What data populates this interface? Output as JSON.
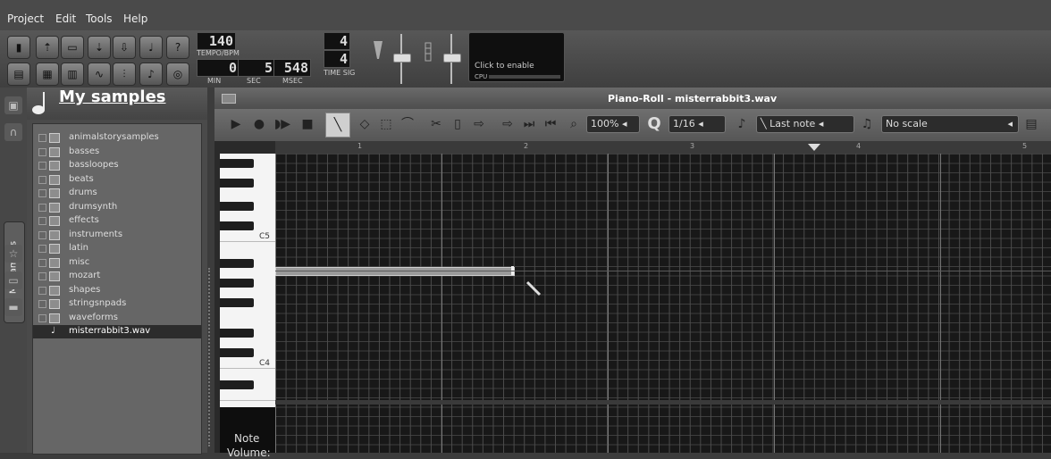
{
  "menu": [
    "Project",
    "Edit",
    "Tools",
    "Help"
  ],
  "transport": {
    "tempo": "140",
    "tempo_label": "TEMPO/BPM",
    "min": "0",
    "sec": "5",
    "msec": "548",
    "min_label": "MIN",
    "sec_label": "SEC",
    "msec_label": "MSEC",
    "timesig_num": "4",
    "timesig_den": "4",
    "timesig_label": "TIME SIG",
    "cpu_text": "Click to enable",
    "cpu_label": "CPU"
  },
  "sidebar": {
    "title": "My samples",
    "tab_label": "My samples",
    "items": [
      "animalstorysamples",
      "basses",
      "bassloopes",
      "beats",
      "drums",
      "drumsynth",
      "effects",
      "instruments",
      "latin",
      "misc",
      "mozart",
      "shapes",
      "stringsnpads",
      "waveforms"
    ],
    "selected_file": "misterrabbit3.wav"
  },
  "piano_roll": {
    "title": "Piano-Roll - misterrabbit3.wav",
    "zoom": "100%",
    "quantize_symbol": "Q",
    "quantize": "1/16",
    "note_length": "Last note",
    "scale": "No scale",
    "bar_numbers": [
      "1",
      "2",
      "3",
      "4",
      "5"
    ],
    "key_labels": [
      "C5",
      "C4"
    ],
    "footer_label": "Note",
    "footer_label2": "Volume:"
  },
  "icons": [
    "play-icon",
    "record-icon",
    "record-play-icon",
    "stop-icon",
    "draw-icon",
    "erase-icon",
    "select-icon",
    "detune-icon",
    "cut-icon",
    "copy-icon",
    "paste-icon",
    "zoom-icon",
    "quantize-icon",
    "note-icon",
    "chord-icon"
  ]
}
